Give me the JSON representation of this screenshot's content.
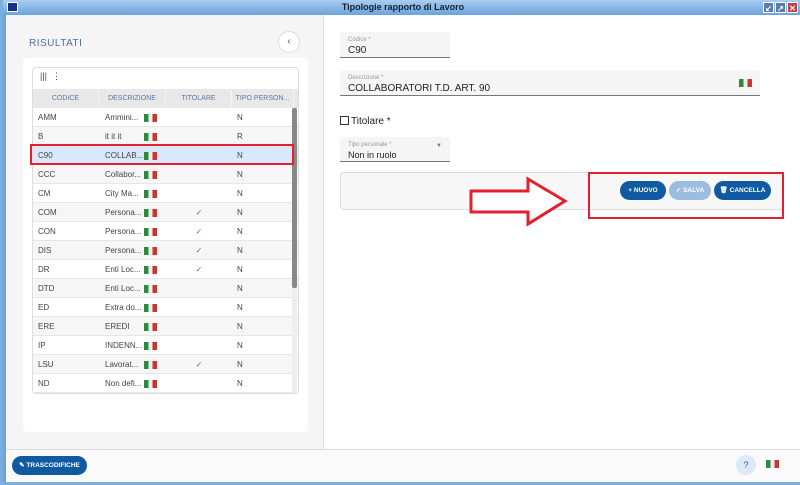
{
  "window": {
    "title": "Tipologie rapporto di Lavoro"
  },
  "left": {
    "title": "RISULTATI",
    "columns": [
      "CODICE",
      "DESCRIZIONE",
      "TITOLARE",
      "TIPO PERSON..."
    ],
    "rows": [
      {
        "code": "AMM",
        "desc": "Ammini...",
        "tit": "",
        "tipo": "N"
      },
      {
        "code": "B",
        "desc": "it it it",
        "tit": "",
        "tipo": "R"
      },
      {
        "code": "C90",
        "desc": "COLLAB...",
        "tit": "",
        "tipo": "N"
      },
      {
        "code": "CCC",
        "desc": "Collabor...",
        "tit": "",
        "tipo": "N"
      },
      {
        "code": "CM",
        "desc": "City Ma...",
        "tit": "",
        "tipo": "N"
      },
      {
        "code": "COM",
        "desc": "Persona...",
        "tit": "✓",
        "tipo": "N"
      },
      {
        "code": "CON",
        "desc": "Persona...",
        "tit": "✓",
        "tipo": "N"
      },
      {
        "code": "DIS",
        "desc": "Persona...",
        "tit": "✓",
        "tipo": "N"
      },
      {
        "code": "DR",
        "desc": "Enti Loc...",
        "tit": "✓",
        "tipo": "N"
      },
      {
        "code": "DTD",
        "desc": "Enti Loc...",
        "tit": "",
        "tipo": "N"
      },
      {
        "code": "ED",
        "desc": "Extra do...",
        "tit": "",
        "tipo": "N"
      },
      {
        "code": "ERE",
        "desc": "EREDI",
        "tit": "",
        "tipo": "N"
      },
      {
        "code": "IP",
        "desc": "INDENN...",
        "tit": "",
        "tipo": "N"
      },
      {
        "code": "LSU",
        "desc": "Lavorat...",
        "tit": "✓",
        "tipo": "N"
      },
      {
        "code": "ND",
        "desc": "Non defi...",
        "tit": "",
        "tipo": "N"
      }
    ]
  },
  "form": {
    "codice": {
      "label": "Codice *",
      "value": "C90"
    },
    "descrizione": {
      "label": "Descrizione *",
      "value": "COLLABORATORI T.D. ART. 90"
    },
    "titolare": {
      "label": "Titolare *"
    },
    "tipo": {
      "label": "Tipo personale *",
      "value": "Non in ruolo"
    },
    "buttons": {
      "nuovo": "+ NUOVO",
      "salva": "✓ SALVA",
      "cancella": "🗑 CANCELLA"
    }
  },
  "footer": {
    "trascodifiche": "TRASCODIFICHE",
    "help": "?"
  }
}
